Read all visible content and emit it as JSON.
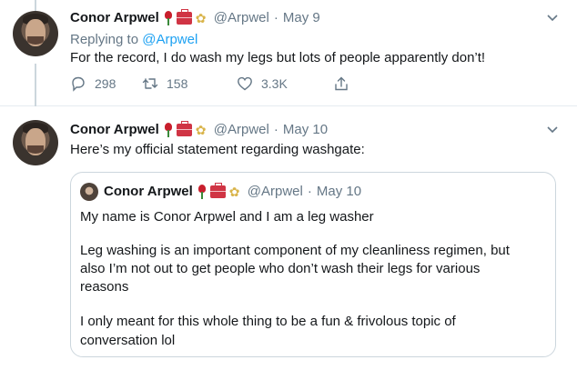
{
  "tweet1": {
    "author_name": "Conor Arpwel",
    "handle": "@Arpwel",
    "separator": "·",
    "date": "May 9",
    "replying_prefix": "Replying to ",
    "replying_handle": "@Arpwel",
    "text": "For the record, I do wash my legs but lots of people apparently don’t!",
    "reply_count": "298",
    "retweet_count": "158",
    "like_count": "3.3K"
  },
  "tweet2": {
    "author_name": "Conor Arpwel",
    "handle": "@Arpwel",
    "separator": "·",
    "date": "May 10",
    "text": "Here’s my official statement regarding washgate:",
    "quote": {
      "author_name": "Conor Arpwel",
      "handle": "@Arpwel",
      "separator": "·",
      "date": "May 10",
      "lines": [
        "My name is Conor Arpwel and I am a leg washer",
        "Leg washing is an important component of my cleanliness regimen, but",
        "also I’m not out to get people who don’t wash their legs for various",
        "reasons",
        "I only meant for this whole thing to be a fun & frivolous topic of",
        "conversation lol"
      ]
    }
  },
  "icons": {
    "name_emojis": [
      "rose-icon",
      "toolbox-icon",
      "wheat-icon"
    ],
    "wheat_glyph": "✿",
    "actions": [
      "reply-icon",
      "retweet-icon",
      "like-icon",
      "share-icon"
    ],
    "menu": "chevron-down-icon"
  },
  "colors": {
    "link": "#1da1f2",
    "secondary_text": "#657786",
    "border": "#ccd6dd"
  }
}
